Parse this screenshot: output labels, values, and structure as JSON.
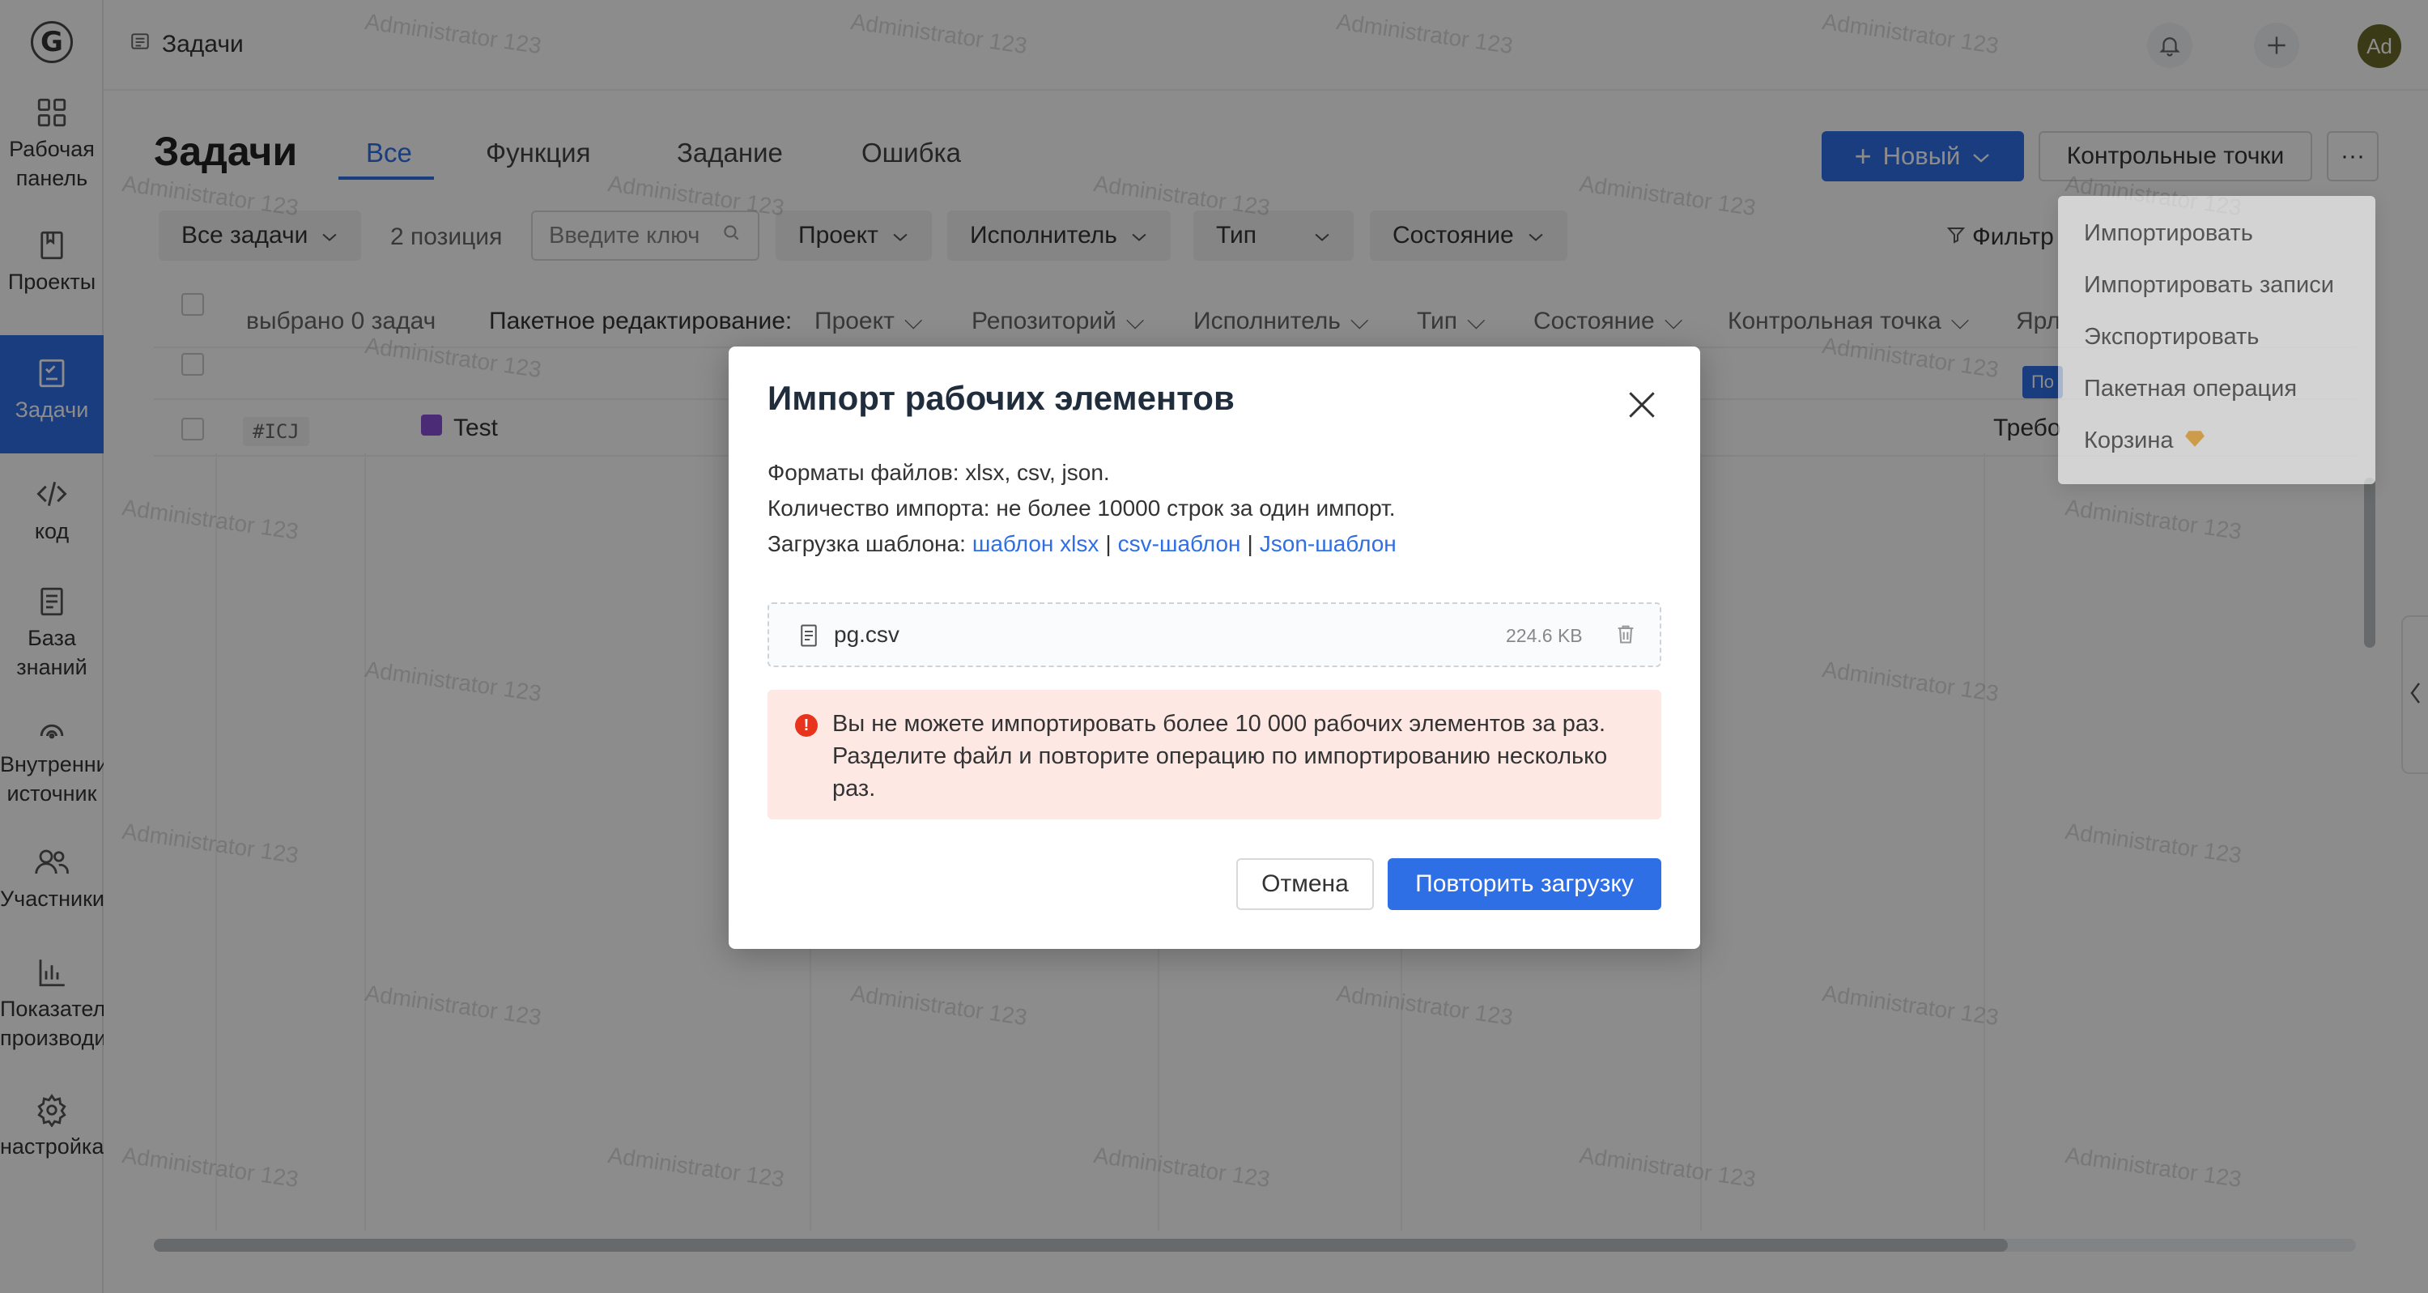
{
  "sidebar": {
    "logo": "G",
    "items": [
      {
        "label": "Рабочая панель",
        "icon": "dashboard-icon"
      },
      {
        "label": "Проекты",
        "icon": "book-icon"
      },
      {
        "label": "Задачи",
        "icon": "tasks-icon",
        "active": true
      },
      {
        "label": "код",
        "icon": "code-icon"
      },
      {
        "label": "База знаний",
        "icon": "document-icon"
      },
      {
        "label": "Внутренний источник",
        "icon": "source-icon"
      },
      {
        "label": "Участники",
        "icon": "users-icon"
      },
      {
        "label": "Показатели производитель",
        "icon": "chart-icon"
      },
      {
        "label": "настройка",
        "icon": "gear-icon"
      }
    ]
  },
  "header": {
    "breadcrumb": "Задачи",
    "avatar": "Ad"
  },
  "page": {
    "title": "Задачи",
    "tabs": [
      "Все",
      "Функция",
      "Задание",
      "Ошибка"
    ],
    "new_button": "Новый",
    "milestones_button": "Контрольные точки",
    "more_button": "···"
  },
  "filters": {
    "all_tasks": "Все задачи",
    "count": "2 позиция",
    "search_placeholder": "Введите ключ",
    "project": "Проект",
    "assignee": "Исполнитель",
    "type": "Тип",
    "status": "Состояние",
    "filter": "Фильтр"
  },
  "table": {
    "selected": "выбрано 0 задач",
    "bulk_label": "Пакетное редактирование:",
    "bulk_fields": [
      "Проект",
      "Репозиторий",
      "Исполнитель",
      "Тип",
      "Состояние",
      "Контрольная точка",
      "Ярл"
    ],
    "row": {
      "id": "#ICJ",
      "title": "Test",
      "status_text": "Требо",
      "tag": "По"
    }
  },
  "dropdown": {
    "items": [
      "Импортировать",
      "Импортировать записи",
      "Экспортировать",
      "Пакетная операция",
      "Корзина"
    ]
  },
  "modal": {
    "title": "Импорт рабочих элементов",
    "formats": "Форматы файлов: xlsx, csv, json.",
    "limit": "Количество импорта: не более 10000 строк за один импорт.",
    "template_label": "Загрузка шаблона:",
    "template_xlsx": "шаблон xlsx",
    "separator": "|",
    "template_csv": "csv-шаблон",
    "template_json": "Json-шаблон",
    "file_name": "pg.csv",
    "file_size": "224.6 KB",
    "error": "Вы не можете импортировать более 10 000 рабочих элементов за раз. Разделите файл и повторите операцию по импортированию несколько раз.",
    "cancel": "Отмена",
    "retry": "Повторить загрузку"
  },
  "watermark": "Administrator 123",
  "colors": {
    "accent": "#2f6fe5",
    "error": "#e8341c",
    "error_bg": "#fde8e4"
  }
}
